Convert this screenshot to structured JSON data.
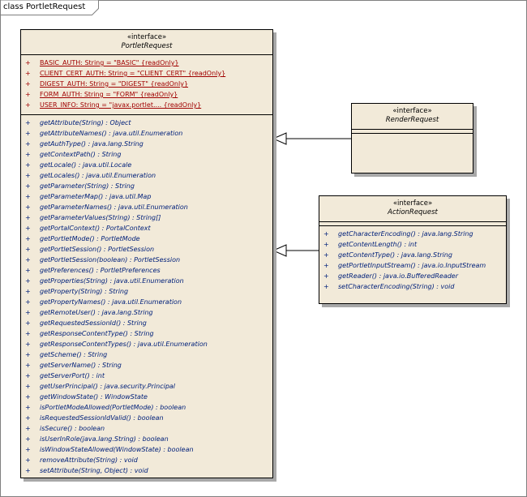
{
  "frame": {
    "title": "class PortletRequest"
  },
  "classes": {
    "portlet_request": {
      "stereotype": "«interface»",
      "name": "PortletRequest",
      "attributes": [
        {
          "vis": "+",
          "text": "BASIC_AUTH:  String = \"BASIC\" {readOnly}"
        },
        {
          "vis": "+",
          "text": "CLIENT_CERT_AUTH:  String = \"CLIENT_CERT\" {readOnly}"
        },
        {
          "vis": "+",
          "text": "DIGEST_AUTH:  String = \"DIGEST\" {readOnly}"
        },
        {
          "vis": "+",
          "text": "FORM_AUTH:  String = \"FORM\" {readOnly}"
        },
        {
          "vis": "+",
          "text": "USER_INFO:  String = \"javax.portlet.... {readOnly}"
        }
      ],
      "operations": [
        {
          "vis": "+",
          "text": "getAttribute(String) : Object"
        },
        {
          "vis": "+",
          "text": "getAttributeNames() : java.util.Enumeration"
        },
        {
          "vis": "+",
          "text": "getAuthType() : java.lang.String"
        },
        {
          "vis": "+",
          "text": "getContextPath() : String"
        },
        {
          "vis": "+",
          "text": "getLocale() : java.util.Locale"
        },
        {
          "vis": "+",
          "text": "getLocales() : java.util.Enumeration"
        },
        {
          "vis": "+",
          "text": "getParameter(String) : String"
        },
        {
          "vis": "+",
          "text": "getParameterMap() : java.util.Map"
        },
        {
          "vis": "+",
          "text": "getParameterNames() : java.util.Enumeration"
        },
        {
          "vis": "+",
          "text": "getParameterValues(String) : String[]"
        },
        {
          "vis": "+",
          "text": "getPortalContext() : PortalContext"
        },
        {
          "vis": "+",
          "text": "getPortletMode() : PortletMode"
        },
        {
          "vis": "+",
          "text": "getPortletSession() : PortletSession"
        },
        {
          "vis": "+",
          "text": "getPortletSession(boolean) : PortletSession"
        },
        {
          "vis": "+",
          "text": "getPreferences() : PortletPreferences"
        },
        {
          "vis": "+",
          "text": "getProperties(String) : java.util.Enumeration"
        },
        {
          "vis": "+",
          "text": "getProperty(String) : String"
        },
        {
          "vis": "+",
          "text": "getPropertyNames() : java.util.Enumeration"
        },
        {
          "vis": "+",
          "text": "getRemoteUser() : java.lang.String"
        },
        {
          "vis": "+",
          "text": "getRequestedSessionId() : String"
        },
        {
          "vis": "+",
          "text": "getResponseContentType() : String"
        },
        {
          "vis": "+",
          "text": "getResponseContentTypes() : java.util.Enumeration"
        },
        {
          "vis": "+",
          "text": "getScheme() : String"
        },
        {
          "vis": "+",
          "text": "getServerName() : String"
        },
        {
          "vis": "+",
          "text": "getServerPort() : int"
        },
        {
          "vis": "+",
          "text": "getUserPrincipal() : java.security.Principal"
        },
        {
          "vis": "+",
          "text": "getWindowState() : WindowState"
        },
        {
          "vis": "+",
          "text": "isPortletModeAllowed(PortletMode) : boolean"
        },
        {
          "vis": "+",
          "text": "isRequestedSessionIdValid() : boolean"
        },
        {
          "vis": "+",
          "text": "isSecure() : boolean"
        },
        {
          "vis": "+",
          "text": "isUserInRole(java.lang.String) : boolean"
        },
        {
          "vis": "+",
          "text": "isWindowStateAllowed(WindowState) : boolean"
        },
        {
          "vis": "+",
          "text": "removeAttribute(String) : void"
        },
        {
          "vis": "+",
          "text": "setAttribute(String, Object) : void"
        }
      ]
    },
    "render_request": {
      "stereotype": "«interface»",
      "name": "RenderRequest"
    },
    "action_request": {
      "stereotype": "«interface»",
      "name": "ActionRequest",
      "operations": [
        {
          "vis": "+",
          "text": "getCharacterEncoding() : java.lang.String"
        },
        {
          "vis": "+",
          "text": "getContentLength() : int"
        },
        {
          "vis": "+",
          "text": "getContentType() : java.lang.String"
        },
        {
          "vis": "+",
          "text": "getPortletInputStream() : java.io.InputStream"
        },
        {
          "vis": "+",
          "text": "getReader() : java.io.BufferedReader"
        },
        {
          "vis": "+",
          "text": "setCharacterEncoding(String) : void"
        }
      ]
    }
  },
  "colors": {
    "class_fill": "#f2ead9",
    "attribute_text": "#a00000",
    "operation_text": "#00207a"
  }
}
